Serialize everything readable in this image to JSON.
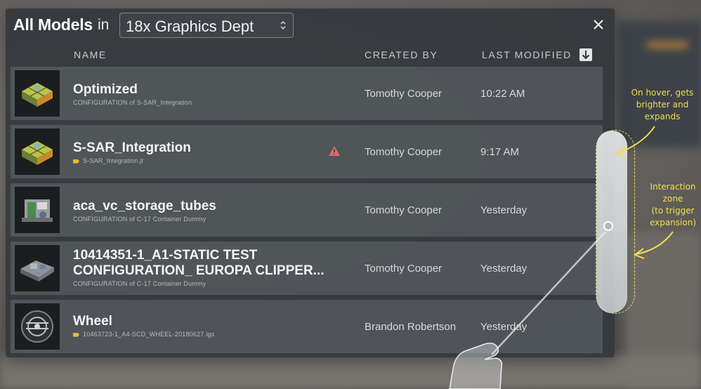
{
  "header": {
    "title": "All Models",
    "in_word": "in",
    "department": "18x Graphics Dept"
  },
  "columns": {
    "name": "NAME",
    "created_by": "CREATED BY",
    "last_modified": "LAST MODIFIED"
  },
  "rows": [
    {
      "name_line1": "Optimized",
      "name_line2": "",
      "subtitle": "CONFIGURATION of S-SAR_Integration",
      "has_tag": false,
      "has_warning": false,
      "created_by": "Tomothy Cooper",
      "modified": "10:22 AM"
    },
    {
      "name_line1": "S-SAR_Integration",
      "name_line2": "",
      "subtitle": "S-SAR_Integration.jt",
      "has_tag": true,
      "has_warning": true,
      "created_by": "Tomothy Cooper",
      "modified": "9:17 AM"
    },
    {
      "name_line1": "aca_vc_storage_tubes",
      "name_line2": "",
      "subtitle": "CONFIGURATION of C-17 Container Dummy",
      "has_tag": false,
      "has_warning": false,
      "created_by": "Tomothy Cooper",
      "modified": "Yesterday"
    },
    {
      "name_line1": "10414351-1_A1-STATIC TEST",
      "name_line2": "CONFIGURATION_ EUROPA CLIPPER...",
      "subtitle": "CONFIGURATION of C-17 Container Dummy",
      "has_tag": false,
      "has_warning": false,
      "created_by": "Tomothy Cooper",
      "modified": "Yesterday"
    },
    {
      "name_line1": "Wheel",
      "name_line2": "",
      "subtitle": "10463723-1_A4-SCD_WHEEL-20180627.igs",
      "has_tag": true,
      "has_warning": false,
      "created_by": "Brandon Robertson",
      "modified": "Yesterday"
    }
  ],
  "annotations": {
    "hover_note_1": "On hover, gets",
    "hover_note_2": "brighter and",
    "hover_note_3": "expands",
    "zone_note_1": "Interaction",
    "zone_note_2": "zone",
    "zone_note_3": "(to trigger",
    "zone_note_4": "expansion)"
  },
  "icons": {
    "close": "close-icon",
    "sort": "arrow-down-icon",
    "dropdown": "chevron-updown-icon",
    "warning": "warning-triangle-icon",
    "tag": "tag-icon"
  },
  "colors": {
    "accent_yellow": "#f3df4c",
    "warning_red": "#e06a6a",
    "tag_yellow": "#e2b93b"
  }
}
